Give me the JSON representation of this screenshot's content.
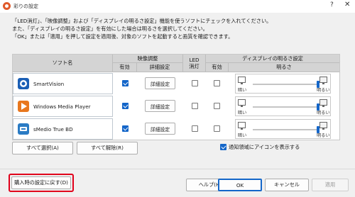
{
  "window": {
    "title": "彩りの設定",
    "help": "?",
    "close": "✕"
  },
  "instructions": [
    "「LED消灯」、「映像調整」および「ディスプレイの明るさ設定」機能を使うソフトにチェックを入れてください。",
    "また、「ディスプレイの明るさ設定」を有効にした場合は明るさを選択してください。",
    "「OK」または「適用」を押して設定を適用後、対象のソフトを起動すると画質を確認できます。"
  ],
  "table": {
    "headers": {
      "soft_name": "ソフト名",
      "video": "映像調整",
      "video_enabled": "有効",
      "video_detail": "詳細設定",
      "led_line1": "LED",
      "led_line2": "消灯",
      "display": "ディスプレイの明るさ設定",
      "display_enabled": "有効",
      "display_brightness": "明るさ"
    },
    "detail_label": "詳細設定",
    "dark_label": "暗い",
    "bright_label": "明るい",
    "rows": [
      {
        "name": "SmartVision",
        "logo_color": "#1b5fb5",
        "video_enabled": true,
        "led_off": false,
        "display_enabled": false,
        "brightness": 1.0
      },
      {
        "name": "Windows Media Player",
        "logo_color": "#e8771e",
        "video_enabled": true,
        "led_off": false,
        "display_enabled": false,
        "brightness": 1.0
      },
      {
        "name": "sMedio True BD",
        "logo_color": "#2a7bc4",
        "video_enabled": true,
        "led_off": false,
        "display_enabled": false,
        "brightness": 1.0
      }
    ]
  },
  "actions": {
    "select_all": "すべて選択(A)",
    "deselect_all": "すべて解除(R)",
    "notify_label": "通知領域にアイコンを表示する",
    "notify_checked": true,
    "restore": "購入時の設定に戻す(D)",
    "help": "ヘルプ(H)",
    "ok": "OK",
    "cancel": "キャンセル",
    "apply": "適用"
  },
  "colors": {
    "accent": "#1466c9",
    "highlight_frame": "#e0001b"
  }
}
